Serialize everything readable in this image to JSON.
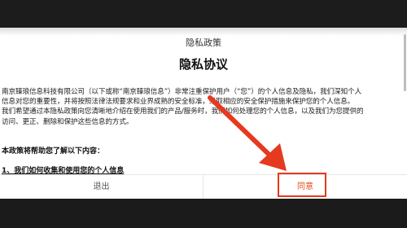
{
  "dialog": {
    "title": "隐私政策",
    "document_title": "隐私协议",
    "body_lines": [
      "南京臻琅信息科技有限公司（以下或称“南京臻琅信息”）非常注重保护用户（“您”）的个人信息及隐私，我们深知个人",
      "信息对您的重要性，并将按照法律法规要求和业界成熟的安全标准，采取相应的安全保护措施来保护您的个人信息。",
      "我们希望通过本隐私政策向您清晰地介绍在使用我们的产品/服务时，我们如何处理您的个人信息，以及我们为您提供的",
      "访问、更正、删除和保护这些信息的方式。"
    ],
    "section_intro": "本政策将帮助您了解以下内容：",
    "section_link": "1、我们如何收集和使用您的个人信息",
    "buttons": {
      "exit_label": "退出",
      "agree_label": "同意"
    }
  },
  "colors": {
    "accent": "#e24a1b",
    "annotation": "#e53a1f",
    "top_bar": "#1c1c1c"
  }
}
